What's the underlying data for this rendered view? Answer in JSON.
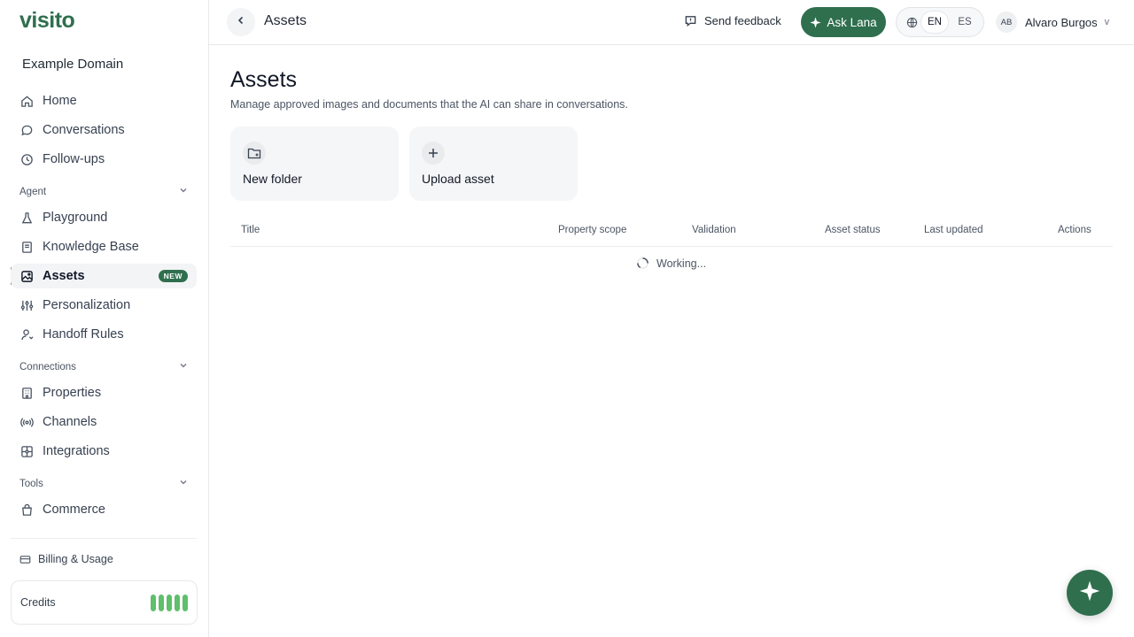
{
  "brand": {
    "logo": "visito",
    "accent": "#2f6f4e"
  },
  "sidebar": {
    "workspace": "Example Domain",
    "main_items": [
      {
        "label": "Home",
        "icon": "home-icon"
      },
      {
        "label": "Conversations",
        "icon": "chat-icon"
      },
      {
        "label": "Follow-ups",
        "icon": "clock-icon"
      }
    ],
    "sections": [
      {
        "title": "Agent",
        "items": [
          {
            "label": "Playground",
            "icon": "flask-icon"
          },
          {
            "label": "Knowledge Base",
            "icon": "book-icon"
          },
          {
            "label": "Assets",
            "icon": "image-icon",
            "badge": "NEW",
            "active": true
          },
          {
            "label": "Personalization",
            "icon": "sliders-icon"
          },
          {
            "label": "Handoff Rules",
            "icon": "person-icon"
          }
        ]
      },
      {
        "title": "Connections",
        "items": [
          {
            "label": "Properties",
            "icon": "building-icon"
          },
          {
            "label": "Channels",
            "icon": "broadcast-icon"
          },
          {
            "label": "Integrations",
            "icon": "puzzle-icon"
          }
        ]
      },
      {
        "title": "Tools",
        "items": [
          {
            "label": "Commerce",
            "icon": "bag-icon"
          }
        ]
      }
    ],
    "billing": "Billing & Usage",
    "credits": {
      "label": "Credits",
      "bars_filled": 5,
      "bars_total": 5,
      "color": "#5fbf6b"
    }
  },
  "topbar": {
    "title": "Assets",
    "feedback": "Send feedback",
    "ask": "Ask Lana",
    "languages": [
      "EN",
      "ES"
    ],
    "selected_language": "EN",
    "user": {
      "initials": "AB",
      "name": "Alvaro Burgos",
      "caret": "v"
    }
  },
  "main": {
    "title": "Assets",
    "subtitle": "Manage approved images and documents that the AI can share in conversations.",
    "actions": [
      {
        "label": "New folder",
        "icon": "folder-plus-icon"
      },
      {
        "label": "Upload asset",
        "icon": "plus-icon"
      }
    ],
    "table": {
      "columns": [
        "Title",
        "Property scope",
        "Validation",
        "Asset status",
        "Last updated",
        "Actions"
      ],
      "status": "Working..."
    }
  }
}
